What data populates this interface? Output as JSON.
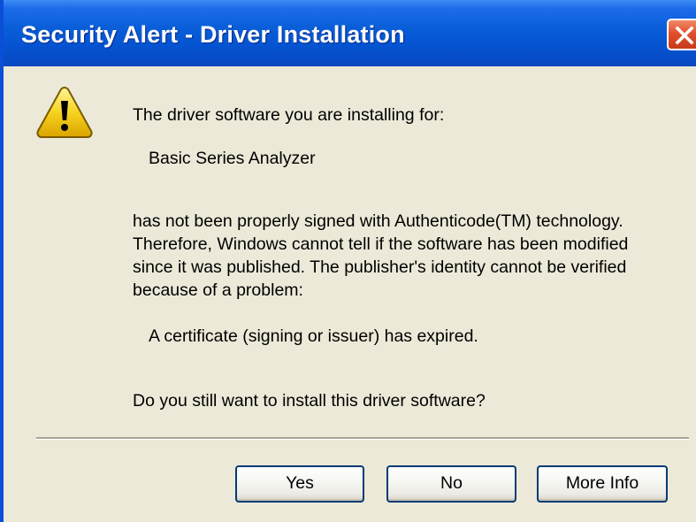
{
  "window": {
    "title": "Security Alert - Driver Installation",
    "close_icon": "close-icon"
  },
  "message": {
    "icon": "warning-icon",
    "intro": "The driver software you are installing for:",
    "device_name": "Basic Series Analyzer",
    "paragraph_lines": [
      "has not been properly signed with Authenticode(TM) technology.",
      "Therefore, Windows cannot tell if the software has been modified",
      "since it was published. The publisher's identity cannot be verified",
      "because of a problem:"
    ],
    "reason": "A certificate (signing or issuer) has expired.",
    "question": "Do you still want to install this driver software?"
  },
  "buttons": {
    "yes_label": "Yes",
    "no_label": "No",
    "more_info_label": "More Info"
  },
  "colors": {
    "title_bar": "#0553d1",
    "dialog_background": "#ece9d8",
    "close_button": "#e0502c",
    "warning_yellow": "#f7d320"
  }
}
